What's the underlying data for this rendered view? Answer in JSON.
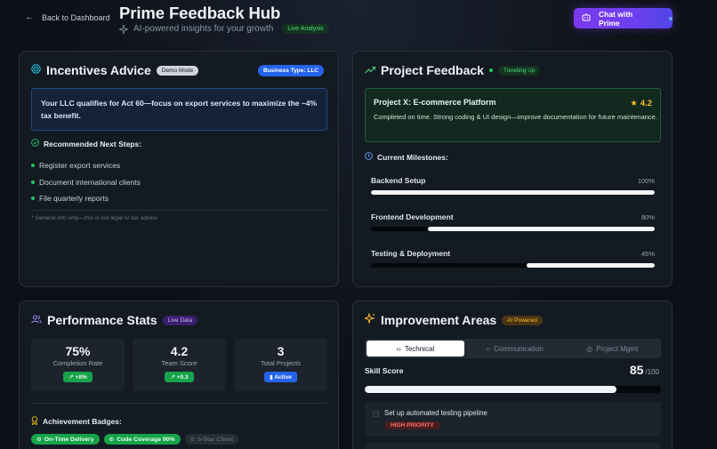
{
  "header": {
    "back_label": "Back to Dashboard",
    "title": "Prime Feedback Hub",
    "subtitle": "AI-powered insights for your growth",
    "live_badge": "Live Analysis",
    "chat_button": "Chat with Prime"
  },
  "incentives": {
    "title": "Incentives Advice",
    "demo_chip": "Demo Mode",
    "business_chip": "Business Type: LLC",
    "advice": "Your LLC qualifies for Act 60—focus on export services to maximize the ~4% tax benefit.",
    "steps_title": "Recommended Next Steps:",
    "steps": [
      "Register export services",
      "Document international clients",
      "File quarterly reports"
    ],
    "disclaimer": "* General info only—this is not legal or tax advice."
  },
  "project": {
    "title": "Project Feedback",
    "trend_chip": "Trending Up",
    "name": "Project X: E-commerce Platform",
    "rating": "4.2",
    "description": "Completed on time. Strong coding & UI design—improve documentation for future maintenance.",
    "milestones_title": "Current Milestones:",
    "milestones": [
      {
        "label": "Backend Setup",
        "pct_text": "100%",
        "progress": 1.0
      },
      {
        "label": "Frontend Development",
        "pct_text": "80%",
        "progress": 0.8
      },
      {
        "label": "Testing & Deployment",
        "pct_text": "45%",
        "progress": 0.45
      }
    ]
  },
  "performance": {
    "title": "Performance Stats",
    "live_chip": "Live Data",
    "stats": [
      {
        "value": "75%",
        "label": "Completion Rate",
        "chip": "+8%"
      },
      {
        "value": "4.2",
        "label": "Team Score",
        "chip": "+0.3"
      },
      {
        "value": "3",
        "label": "Total Projects",
        "chip": "Active"
      }
    ],
    "badges_title": "Achievement Badges:",
    "badges": [
      "On-Time Delivery",
      "Code Coverage 90%",
      "5-Star Client"
    ]
  },
  "improvement": {
    "title": "Improvement Areas",
    "ai_chip": "AI Powered",
    "tabs": [
      "Technical",
      "Communication",
      "Project Mgmt"
    ],
    "skill_label": "Skill Score",
    "skill_score": "85",
    "skill_max": "/100",
    "skill_progress": 0.85,
    "task": "Set up automated testing pipeline",
    "priority": "HIGH PRIORITY"
  },
  "colors": {
    "accent_purple": "#7c3aed",
    "success_green": "#22c55e",
    "info_blue": "#2563eb",
    "star_gold": "#fbbf24"
  }
}
